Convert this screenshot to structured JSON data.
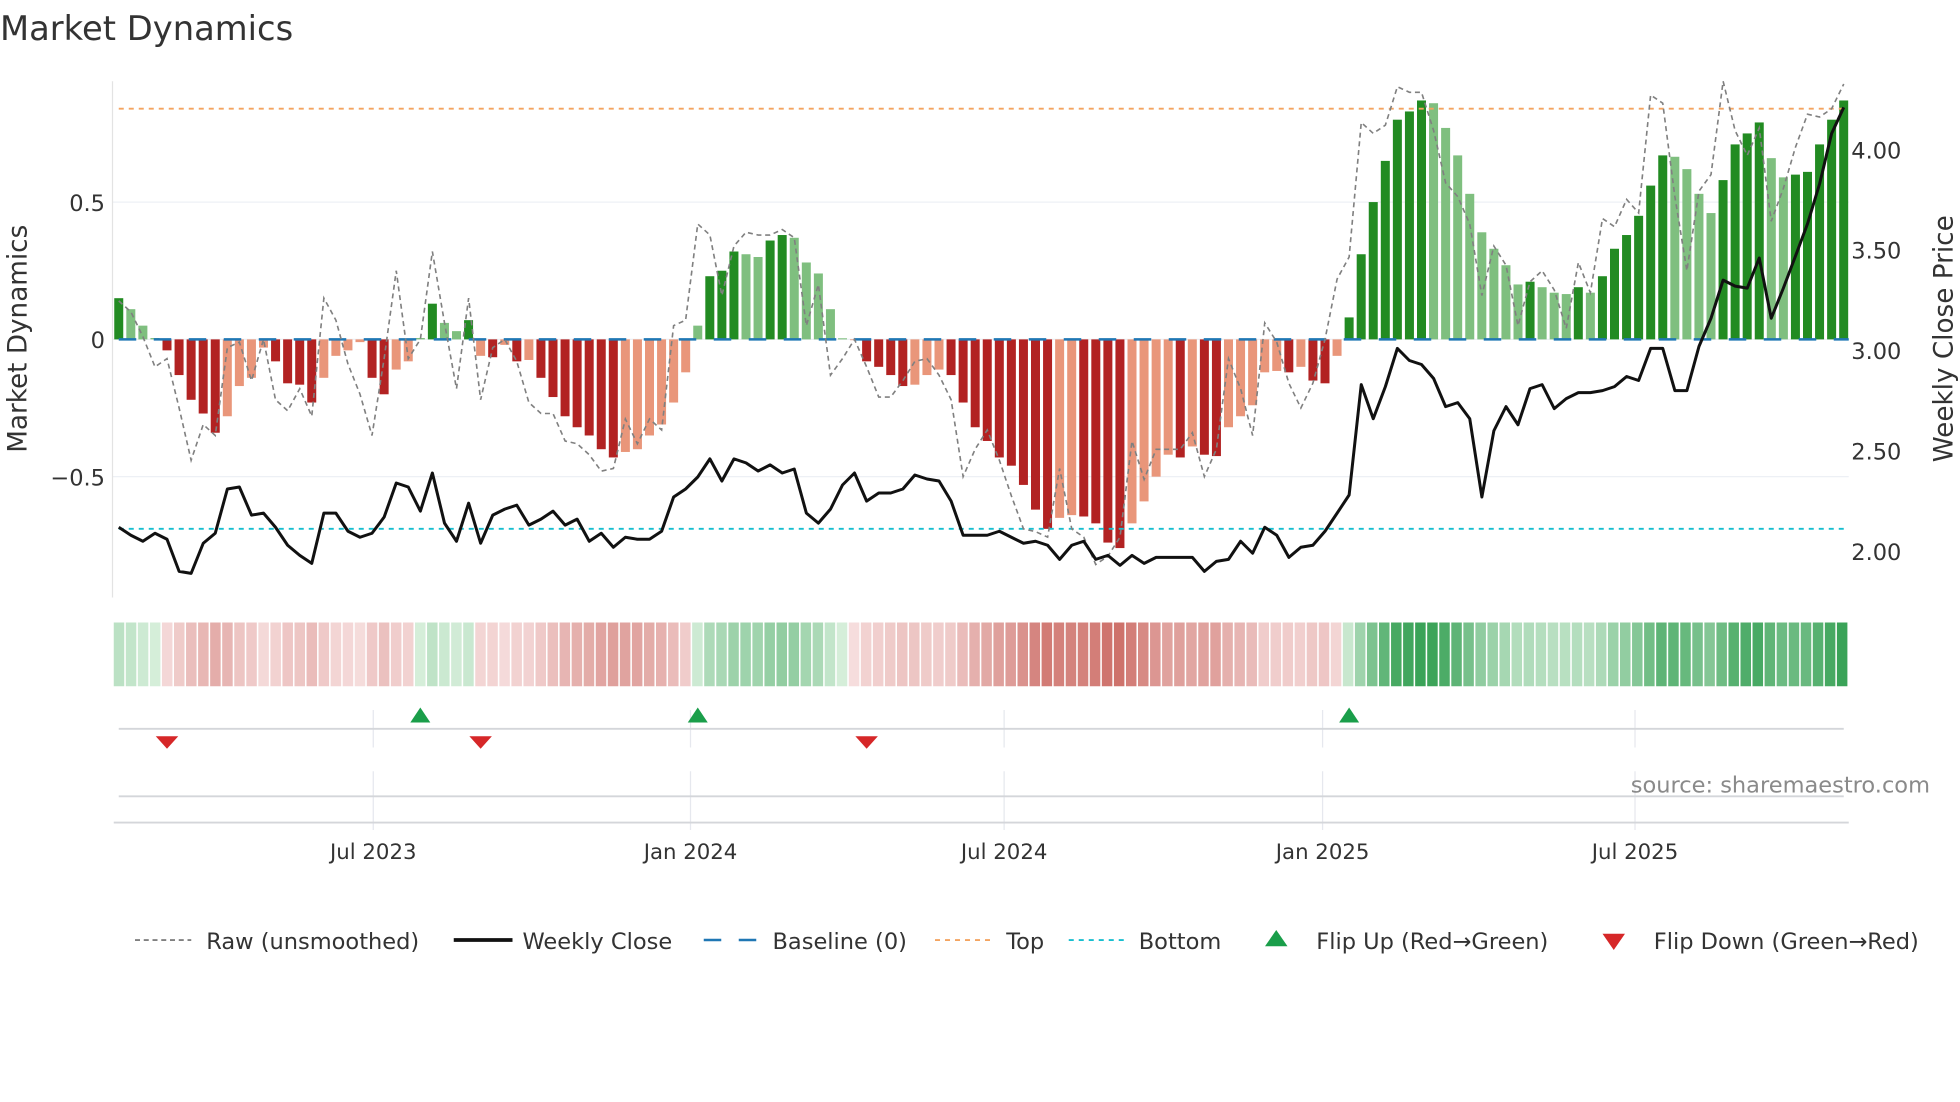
{
  "title": "Market Dynamics",
  "source": "source: sharemaestro.com",
  "colors": {
    "pos_dark": "#228b22",
    "pos_light": "#7fbf7f",
    "neg_dark": "#b22222",
    "neg_light": "#e9967a",
    "close": "#111111",
    "raw": "#808080",
    "baseline": "#1f77b4",
    "top": "#f4a460",
    "bottom": "#17becf",
    "flip_up": "#1a9e4a",
    "flip_down": "#d62728"
  },
  "chart_data": {
    "type": "bar",
    "title": "Market Dynamics",
    "ylabel": "Market Dynamics",
    "y2label": "Weekly Close Price",
    "ylim": [
      -0.94,
      0.94
    ],
    "y2lim": [
      1.77,
      4.34
    ],
    "yticks": [
      {
        "v": 0.5,
        "label": "0.5"
      },
      {
        "v": 0,
        "label": "0"
      },
      {
        "v": -0.5,
        "label": "−0.5"
      }
    ],
    "y2ticks": [
      {
        "v": 2.0,
        "label": "2.00"
      },
      {
        "v": 2.5,
        "label": "2.50"
      },
      {
        "v": 3.0,
        "label": "3.00"
      },
      {
        "v": 3.5,
        "label": "3.50"
      },
      {
        "v": 4.0,
        "label": "4.00"
      }
    ],
    "xticks": [
      {
        "i": 21.1,
        "label": "Jul 2023"
      },
      {
        "i": 47.4,
        "label": "Jan 2024"
      },
      {
        "i": 73.4,
        "label": "Jul 2024"
      },
      {
        "i": 99.8,
        "label": "Jan 2025"
      },
      {
        "i": 125.7,
        "label": "Jul 2025"
      }
    ],
    "top_level": 0.84,
    "bottom_level": -0.69,
    "baseline": 0,
    "momentum": [
      0.15,
      0.11,
      0.05,
      0.005,
      -0.04,
      -0.13,
      -0.22,
      -0.27,
      -0.34,
      -0.28,
      -0.17,
      -0.14,
      -0.03,
      -0.08,
      -0.16,
      -0.165,
      -0.23,
      -0.14,
      -0.06,
      -0.04,
      -0.01,
      -0.14,
      -0.2,
      -0.11,
      -0.08,
      0.005,
      0.13,
      0.06,
      0.03,
      0.07,
      -0.06,
      -0.065,
      -0.02,
      -0.08,
      -0.075,
      -0.14,
      -0.21,
      -0.28,
      -0.32,
      -0.35,
      -0.4,
      -0.43,
      -0.41,
      -0.4,
      -0.35,
      -0.31,
      -0.23,
      -0.12,
      0.05,
      0.23,
      0.25,
      0.32,
      0.31,
      0.3,
      0.36,
      0.38,
      0.37,
      0.28,
      0.24,
      0.11,
      0.004,
      -0.003,
      -0.08,
      -0.1,
      -0.13,
      -0.17,
      -0.165,
      -0.13,
      -0.11,
      -0.13,
      -0.23,
      -0.32,
      -0.37,
      -0.43,
      -0.46,
      -0.53,
      -0.62,
      -0.69,
      -0.65,
      -0.64,
      -0.645,
      -0.67,
      -0.74,
      -0.76,
      -0.67,
      -0.59,
      -0.5,
      -0.42,
      -0.43,
      -0.39,
      -0.42,
      -0.425,
      -0.32,
      -0.28,
      -0.24,
      -0.12,
      -0.115,
      -0.12,
      -0.1,
      -0.15,
      -0.16,
      -0.06,
      0.08,
      0.31,
      0.5,
      0.65,
      0.8,
      0.83,
      0.87,
      0.86,
      0.77,
      0.67,
      0.53,
      0.39,
      0.33,
      0.27,
      0.2,
      0.21,
      0.19,
      0.17,
      0.165,
      0.19,
      0.17,
      0.23,
      0.33,
      0.38,
      0.45,
      0.56,
      0.67,
      0.665,
      0.62,
      0.53,
      0.46,
      0.58,
      0.71,
      0.75,
      0.79,
      0.66,
      0.59,
      0.6,
      0.61,
      0.71,
      0.8,
      0.87
    ],
    "raw": [
      0.14,
      0.1,
      0.01,
      -0.1,
      -0.07,
      -0.25,
      -0.44,
      -0.31,
      -0.35,
      -0.03,
      -0.01,
      -0.15,
      0.0,
      -0.22,
      -0.26,
      -0.18,
      -0.28,
      0.15,
      0.07,
      -0.09,
      -0.2,
      -0.35,
      -0.07,
      0.25,
      -0.07,
      0.0,
      0.32,
      0.06,
      -0.18,
      0.15,
      -0.22,
      -0.03,
      0.0,
      -0.08,
      -0.23,
      -0.27,
      -0.27,
      -0.37,
      -0.38,
      -0.42,
      -0.48,
      -0.47,
      -0.29,
      -0.38,
      -0.29,
      -0.33,
      0.05,
      0.07,
      0.42,
      0.38,
      0.16,
      0.34,
      0.39,
      0.38,
      0.38,
      0.4,
      0.37,
      0.05,
      0.2,
      -0.13,
      -0.07,
      0.0,
      -0.1,
      -0.21,
      -0.21,
      -0.15,
      -0.08,
      -0.07,
      -0.13,
      -0.22,
      -0.5,
      -0.4,
      -0.33,
      -0.44,
      -0.57,
      -0.69,
      -0.7,
      -0.72,
      -0.47,
      -0.69,
      -0.72,
      -0.82,
      -0.79,
      -0.72,
      -0.37,
      -0.51,
      -0.4,
      -0.4,
      -0.4,
      -0.34,
      -0.5,
      -0.4,
      -0.07,
      -0.18,
      -0.35,
      0.06,
      -0.01,
      -0.16,
      -0.25,
      -0.16,
      0.0,
      0.22,
      0.3,
      0.79,
      0.75,
      0.78,
      0.92,
      0.9,
      0.9,
      0.76,
      0.57,
      0.52,
      0.42,
      0.16,
      0.34,
      0.27,
      0.05,
      0.21,
      0.25,
      0.18,
      0.04,
      0.28,
      0.17,
      0.44,
      0.41,
      0.51,
      0.46,
      0.89,
      0.86,
      0.52,
      0.25,
      0.54,
      0.6,
      0.94,
      0.76,
      0.67,
      0.77,
      0.43,
      0.55,
      0.7,
      0.82,
      0.81,
      0.84,
      0.93
    ],
    "close": [
      2.12,
      2.08,
      2.05,
      2.09,
      2.06,
      1.9,
      1.89,
      2.04,
      2.09,
      2.31,
      2.32,
      2.18,
      2.19,
      2.12,
      2.03,
      1.98,
      1.94,
      2.19,
      2.19,
      2.1,
      2.07,
      2.09,
      2.17,
      2.34,
      2.32,
      2.2,
      2.39,
      2.14,
      2.05,
      2.24,
      2.04,
      2.18,
      2.21,
      2.23,
      2.13,
      2.16,
      2.2,
      2.13,
      2.16,
      2.05,
      2.09,
      2.02,
      2.07,
      2.06,
      2.06,
      2.1,
      2.27,
      2.31,
      2.37,
      2.46,
      2.35,
      2.46,
      2.44,
      2.4,
      2.43,
      2.39,
      2.41,
      2.19,
      2.14,
      2.21,
      2.33,
      2.39,
      2.25,
      2.29,
      2.29,
      2.31,
      2.38,
      2.36,
      2.35,
      2.25,
      2.08,
      2.08,
      2.08,
      2.1,
      2.07,
      2.04,
      2.05,
      2.03,
      1.96,
      2.03,
      2.05,
      1.96,
      1.98,
      1.93,
      1.98,
      1.94,
      1.97,
      1.97,
      1.97,
      1.97,
      1.9,
      1.95,
      1.96,
      2.05,
      1.99,
      2.12,
      2.08,
      1.97,
      2.02,
      2.03,
      2.1,
      2.19,
      2.28,
      2.83,
      2.66,
      2.82,
      3.01,
      2.95,
      2.93,
      2.86,
      2.72,
      2.74,
      2.66,
      2.27,
      2.6,
      2.72,
      2.63,
      2.81,
      2.83,
      2.71,
      2.76,
      2.79,
      2.79,
      2.8,
      2.82,
      2.87,
      2.85,
      3.01,
      3.01,
      2.8,
      2.8,
      3.02,
      3.16,
      3.35,
      3.32,
      3.31,
      3.46,
      3.16,
      3.31,
      3.47,
      3.63,
      3.83,
      4.08,
      4.21
    ],
    "flips_up": [
      25,
      48,
      102
    ],
    "flips_down": [
      4,
      30,
      62
    ],
    "legend": [
      {
        "key": "raw",
        "label": "Raw (unsmoothed)"
      },
      {
        "key": "close",
        "label": "Weekly Close"
      },
      {
        "key": "baseline",
        "label": "Baseline (0)"
      },
      {
        "key": "top",
        "label": "Top"
      },
      {
        "key": "bottom",
        "label": "Bottom"
      },
      {
        "key": "flip_up",
        "label": "Flip Up (Red→Green)"
      },
      {
        "key": "flip_down",
        "label": "Flip Down (Green→Red)"
      }
    ],
    "legend_position": "bottom"
  }
}
